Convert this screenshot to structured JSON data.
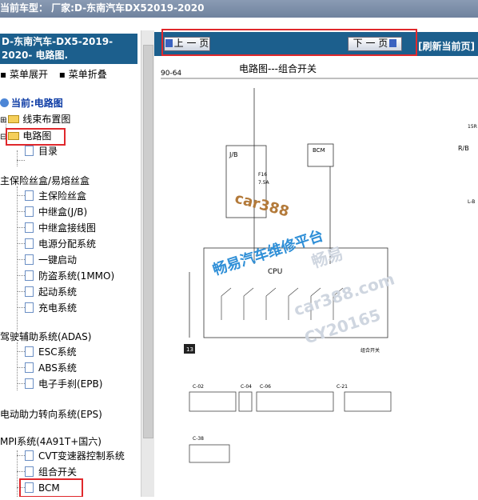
{
  "topbar": {
    "text": "当前车型：  厂家:D-东南汽车DX52019-2020"
  },
  "sidebar": {
    "title": "D-东南汽车-DX5-2019-2020- 电路图.",
    "expand_label": "菜单展开",
    "collapse_label": "菜单折叠",
    "current_label": "当前:电路图",
    "tree": [
      {
        "label": "线束布置图",
        "type": "folder"
      },
      {
        "label": "电路图",
        "type": "folder"
      },
      {
        "label": "目录",
        "type": "doc"
      },
      {
        "label": "主保险丝盒/易熔丝盒",
        "type": "text"
      },
      {
        "label": "主保险丝盒",
        "type": "doc"
      },
      {
        "label": "中继盒(J/B)",
        "type": "doc"
      },
      {
        "label": "中继盒接线图",
        "type": "doc"
      },
      {
        "label": "电源分配系统",
        "type": "doc"
      },
      {
        "label": "一键启动",
        "type": "doc"
      },
      {
        "label": "防盗系统(1MMO)",
        "type": "doc"
      },
      {
        "label": "起动系统",
        "type": "doc"
      },
      {
        "label": "充电系统",
        "type": "doc"
      },
      {
        "label": "驾驶辅助系统(ADAS)",
        "type": "text"
      },
      {
        "label": "ESC系统",
        "type": "doc"
      },
      {
        "label": "ABS系统",
        "type": "doc"
      },
      {
        "label": "电子手刹(EPB)",
        "type": "doc"
      },
      {
        "label": "电动助力转向系统(EPS)",
        "type": "text"
      },
      {
        "label": "MPI系统(4A91T+国六)",
        "type": "text"
      },
      {
        "label": "CVT变速器控制系统",
        "type": "doc"
      },
      {
        "label": "组合开关",
        "type": "doc"
      },
      {
        "label": "BCM",
        "type": "doc"
      }
    ]
  },
  "nav": {
    "prev_label": "上 一 页",
    "next_label": "下 一 页",
    "refresh_label": "[刷新当前页]"
  },
  "diagram": {
    "page_no": "90-64",
    "title": "电路图---组合开关",
    "fuse_box": "J/B",
    "fuse": "F16",
    "fuse_rating": "7.5A",
    "bcm_label": "BCM",
    "cpu_label": "CPU",
    "ground": "13",
    "combo_label": "组合开关",
    "connectors": [
      "C-02",
      "C-04",
      "C-06",
      "C-21",
      "C-38"
    ],
    "right_label": "R/B",
    "right_label2": "L-B",
    "right_code": "15R",
    "watermarks": {
      "wm1": "car388",
      "wm2": "畅易汽车维修平台",
      "wm3": "畅易",
      "wm4": "car388.com",
      "wm5": "CY20165"
    }
  }
}
